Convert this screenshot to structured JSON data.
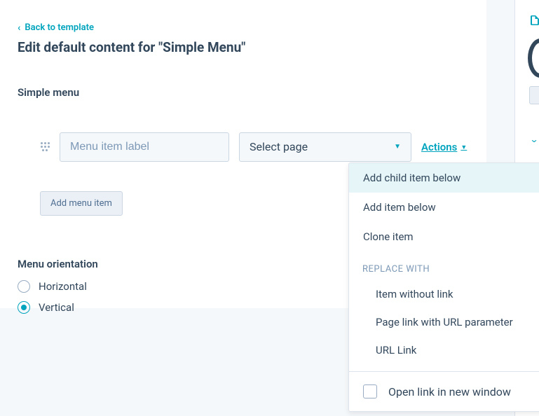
{
  "back_link": "Back to template",
  "page_title": "Edit default content for \"Simple Menu\"",
  "section_label": "Simple menu",
  "menu_item_placeholder": "Menu item label",
  "select_placeholder": "Select page",
  "actions_label": "Actions",
  "add_button": "Add menu item",
  "orientation_label": "Menu orientation",
  "orientation": {
    "horizontal": "Horizontal",
    "vertical": "Vertical"
  },
  "dropdown": {
    "add_child": "Add child item below",
    "add_below": "Add item below",
    "clone": "Clone item",
    "replace_header": "REPLACE WITH",
    "item_without_link": "Item without link",
    "page_link_param": "Page link with URL parameter",
    "url_link": "URL Link",
    "open_new_window": "Open link in new window"
  }
}
